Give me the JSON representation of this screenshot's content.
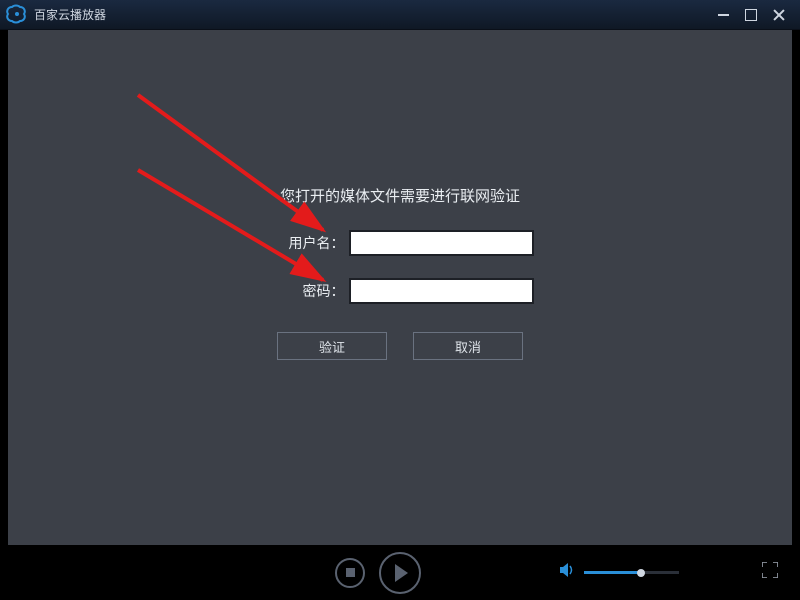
{
  "app": {
    "title": "百家云播放器"
  },
  "dialog": {
    "message": "您打开的媒体文件需要进行联网验证",
    "username_label": "用户名：",
    "password_label": "密码：",
    "username_value": "",
    "password_value": "",
    "verify_label": "验证",
    "cancel_label": "取消"
  },
  "player": {
    "volume_percent": 60
  },
  "colors": {
    "accent": "#2a8fd8",
    "panel": "#3c4048",
    "arrow": "#e31b1b"
  }
}
